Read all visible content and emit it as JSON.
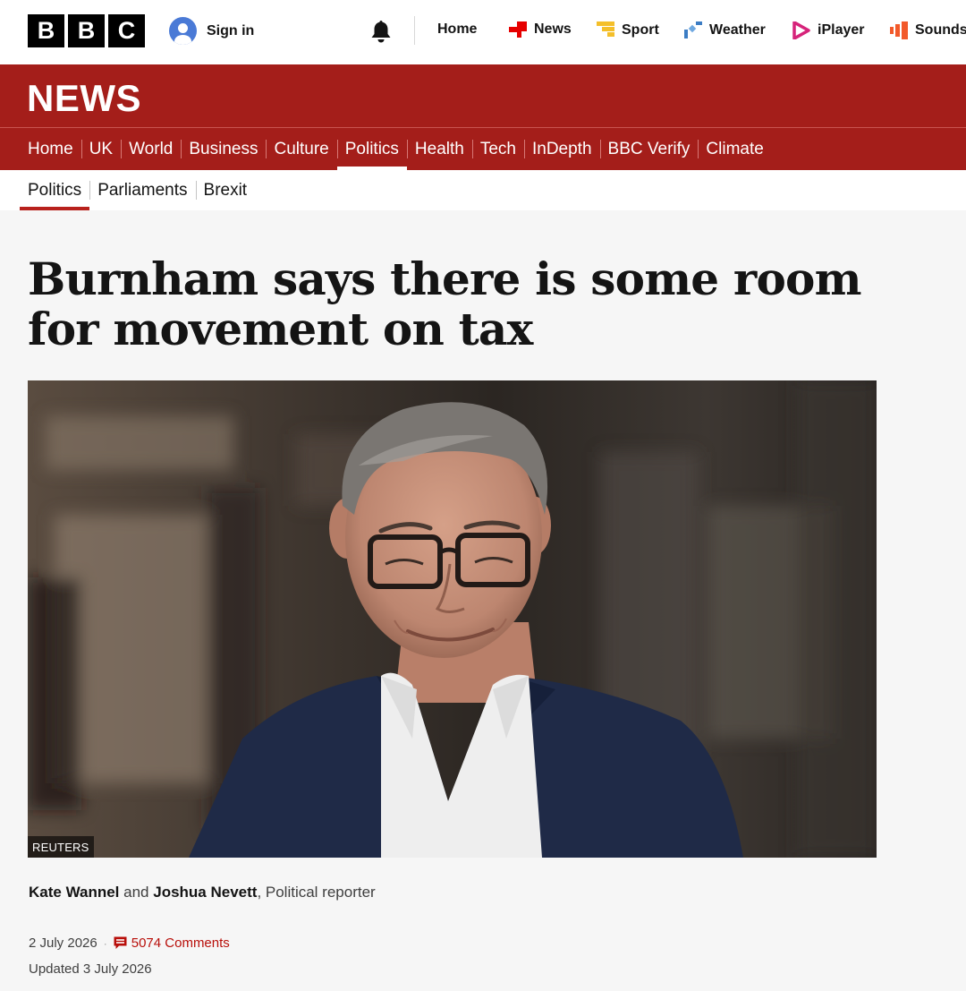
{
  "header": {
    "logo_letters": [
      "B",
      "B",
      "C"
    ],
    "sign_in_label": "Sign in",
    "nav": [
      {
        "label": "Home",
        "icon": "none"
      },
      {
        "label": "News",
        "icon": "news-icon",
        "color": "#e60000"
      },
      {
        "label": "Sport",
        "icon": "sport-icon",
        "color": "#f4bf2a"
      },
      {
        "label": "Weather",
        "icon": "weather-icon",
        "color": "#3c7dc4"
      },
      {
        "label": "iPlayer",
        "icon": "iplayer-icon",
        "color": "#d6237a"
      },
      {
        "label": "Sounds",
        "icon": "sounds-icon",
        "color": "#f2592a"
      }
    ]
  },
  "news_band": {
    "wordmark": "NEWS",
    "background": "#a41e1a",
    "primary_nav": [
      "Home",
      "UK",
      "World",
      "Business",
      "Culture",
      "Politics",
      "Health",
      "Tech",
      "InDepth",
      "BBC Verify",
      "Climate"
    ],
    "active": "Politics"
  },
  "section_nav": {
    "items": [
      "Politics",
      "Parliaments",
      "Brexit"
    ],
    "active": "Politics"
  },
  "article": {
    "headline": "Burnham says there is some room for movement on tax",
    "image_credit": "REUTERS",
    "byline": {
      "author1": "Kate Wannel",
      "joiner": "and",
      "author2": "Joshua Nevett",
      "role": ", Political reporter"
    },
    "date": "2 July 2026",
    "comments": "5074 Comments",
    "updated": "Updated 3 July 2026"
  }
}
